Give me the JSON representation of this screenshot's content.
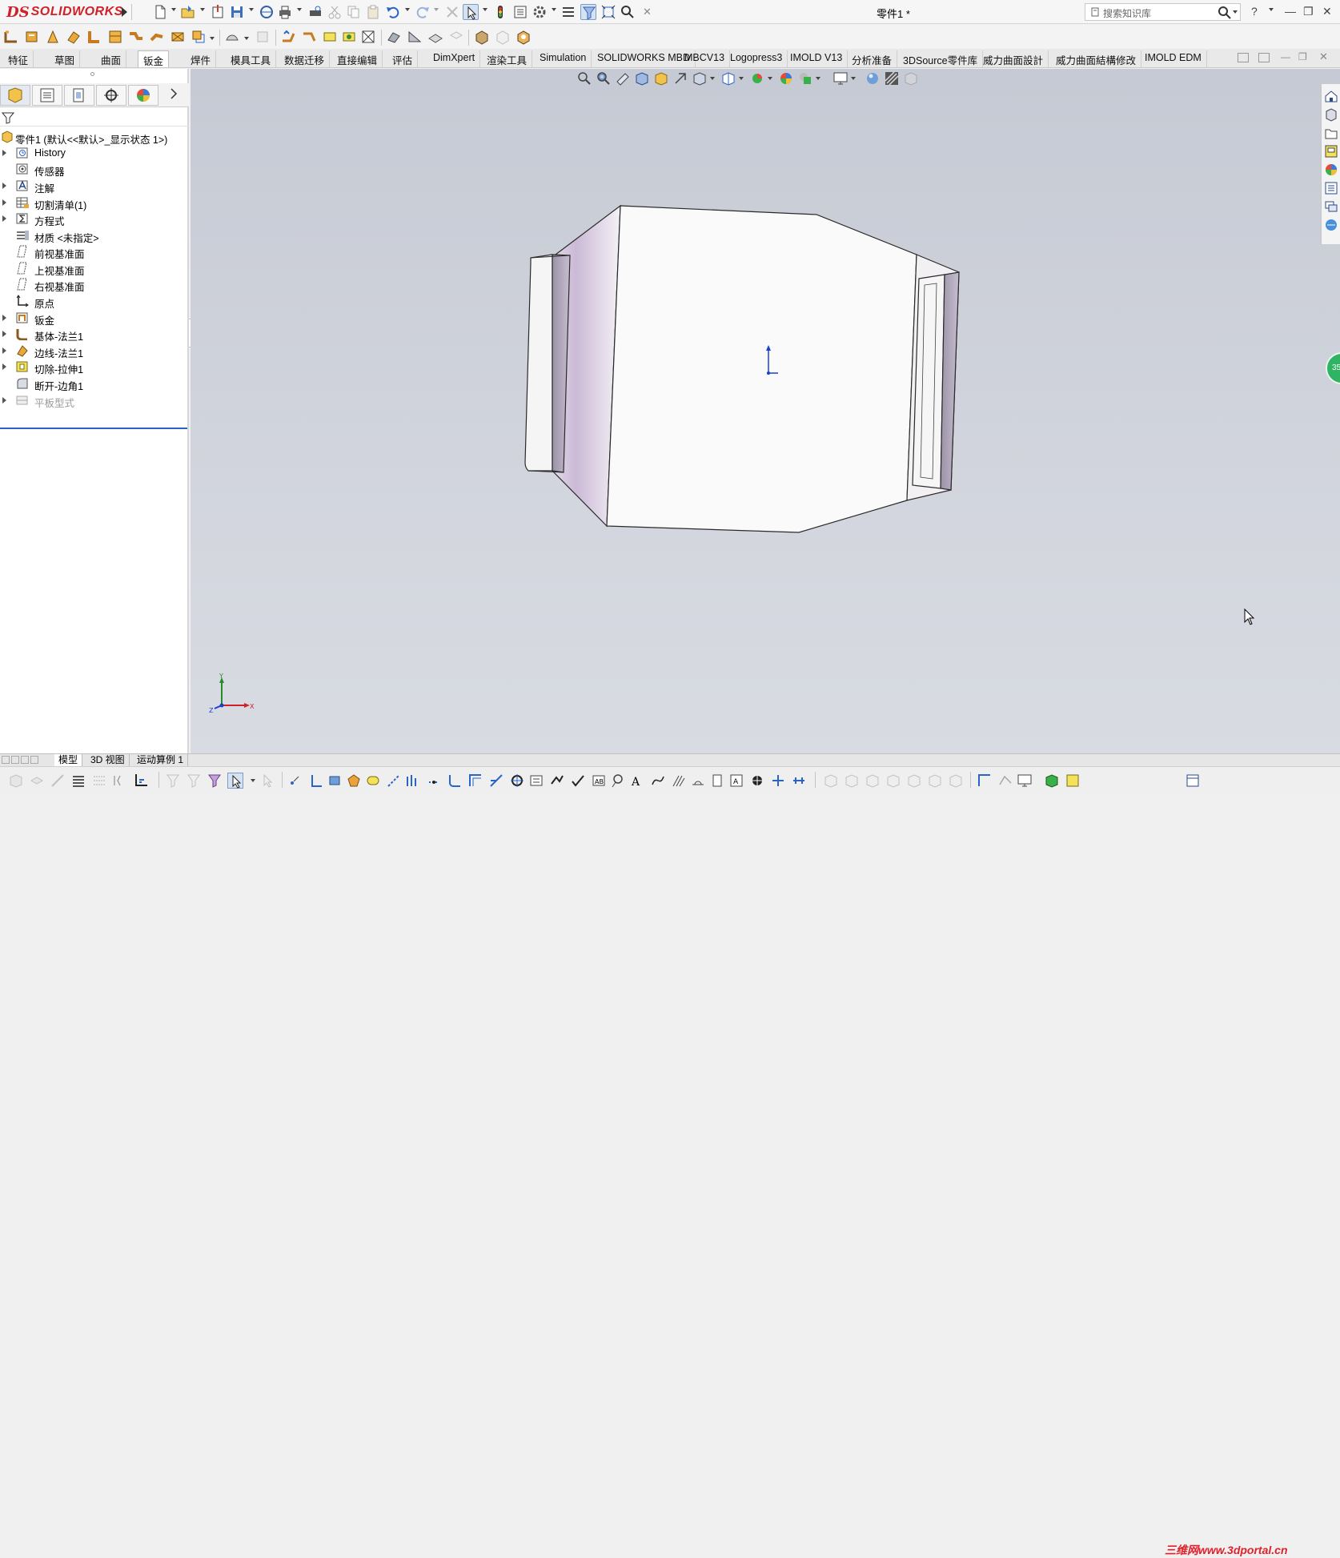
{
  "app": {
    "brand_ds": "DS",
    "brand_name": "SOLIDWORKS",
    "document_title": "零件1 *"
  },
  "search": {
    "placeholder": "搜索知识库"
  },
  "window_controls": {
    "help": "?",
    "minimize": "—",
    "restore": "❐",
    "close": "✕"
  },
  "tabs": [
    {
      "label": "特征"
    },
    {
      "label": "草图"
    },
    {
      "label": "曲面"
    },
    {
      "label": "钣金",
      "active": true
    },
    {
      "label": "焊件"
    },
    {
      "label": "模具工具"
    },
    {
      "label": "数据迁移"
    },
    {
      "label": "直接编辑"
    },
    {
      "label": "评估"
    },
    {
      "label": "DimXpert"
    },
    {
      "label": "渲染工具"
    },
    {
      "label": "Simulation"
    },
    {
      "label": "SOLIDWORKS MBD"
    },
    {
      "label": "MBCV13"
    },
    {
      "label": "Logopress3"
    },
    {
      "label": "IMOLD V13"
    },
    {
      "label": "分析准备"
    },
    {
      "label": "3DSource零件库"
    },
    {
      "label": "威力曲面設計"
    },
    {
      "label": "威力曲面結構修改"
    },
    {
      "label": "IMOLD EDM"
    }
  ],
  "tree": {
    "root": "零件1 (默认<<默认>_显示状态 1>)",
    "items": [
      {
        "label": "History",
        "icon": "history-icon",
        "expandable": true
      },
      {
        "label": "传感器",
        "icon": "sensor-icon",
        "expandable": false
      },
      {
        "label": "注解",
        "icon": "annotation-icon",
        "expandable": true
      },
      {
        "label": "切割清单(1)",
        "icon": "cut-list-icon",
        "expandable": true
      },
      {
        "label": "方程式",
        "icon": "equation-icon",
        "expandable": true
      },
      {
        "label": "材质 <未指定>",
        "icon": "material-icon",
        "expandable": false
      },
      {
        "label": "前视基准面",
        "icon": "plane-icon",
        "expandable": false
      },
      {
        "label": "上视基准面",
        "icon": "plane-icon",
        "expandable": false
      },
      {
        "label": "右视基准面",
        "icon": "plane-icon",
        "expandable": false
      },
      {
        "label": "原点",
        "icon": "origin-icon",
        "expandable": false
      },
      {
        "label": "钣金",
        "icon": "sheet-metal-icon",
        "expandable": true
      },
      {
        "label": "基体-法兰1",
        "icon": "base-flange-icon",
        "expandable": true
      },
      {
        "label": "边线-法兰1",
        "icon": "edge-flange-icon",
        "expandable": true
      },
      {
        "label": "切除-拉伸1",
        "icon": "cut-extrude-icon",
        "expandable": true
      },
      {
        "label": "断开-边角1",
        "icon": "break-corner-icon",
        "expandable": false
      },
      {
        "label": "平板型式",
        "icon": "flat-pattern-icon",
        "expandable": true,
        "suppressed": true
      }
    ]
  },
  "bottom_tabs": [
    {
      "label": "模型",
      "active": true
    },
    {
      "label": "3D 视图"
    },
    {
      "label": "运动算例 1"
    }
  ],
  "triad": {
    "x": "X",
    "y": "Y",
    "z": "Z"
  },
  "badge": "35",
  "watermark": "三维网www.3dportal.cn",
  "colors": {
    "brand": "#d0202a",
    "rollback_bar": "#2a64c8",
    "active_tab_bg": "#ffffff"
  }
}
